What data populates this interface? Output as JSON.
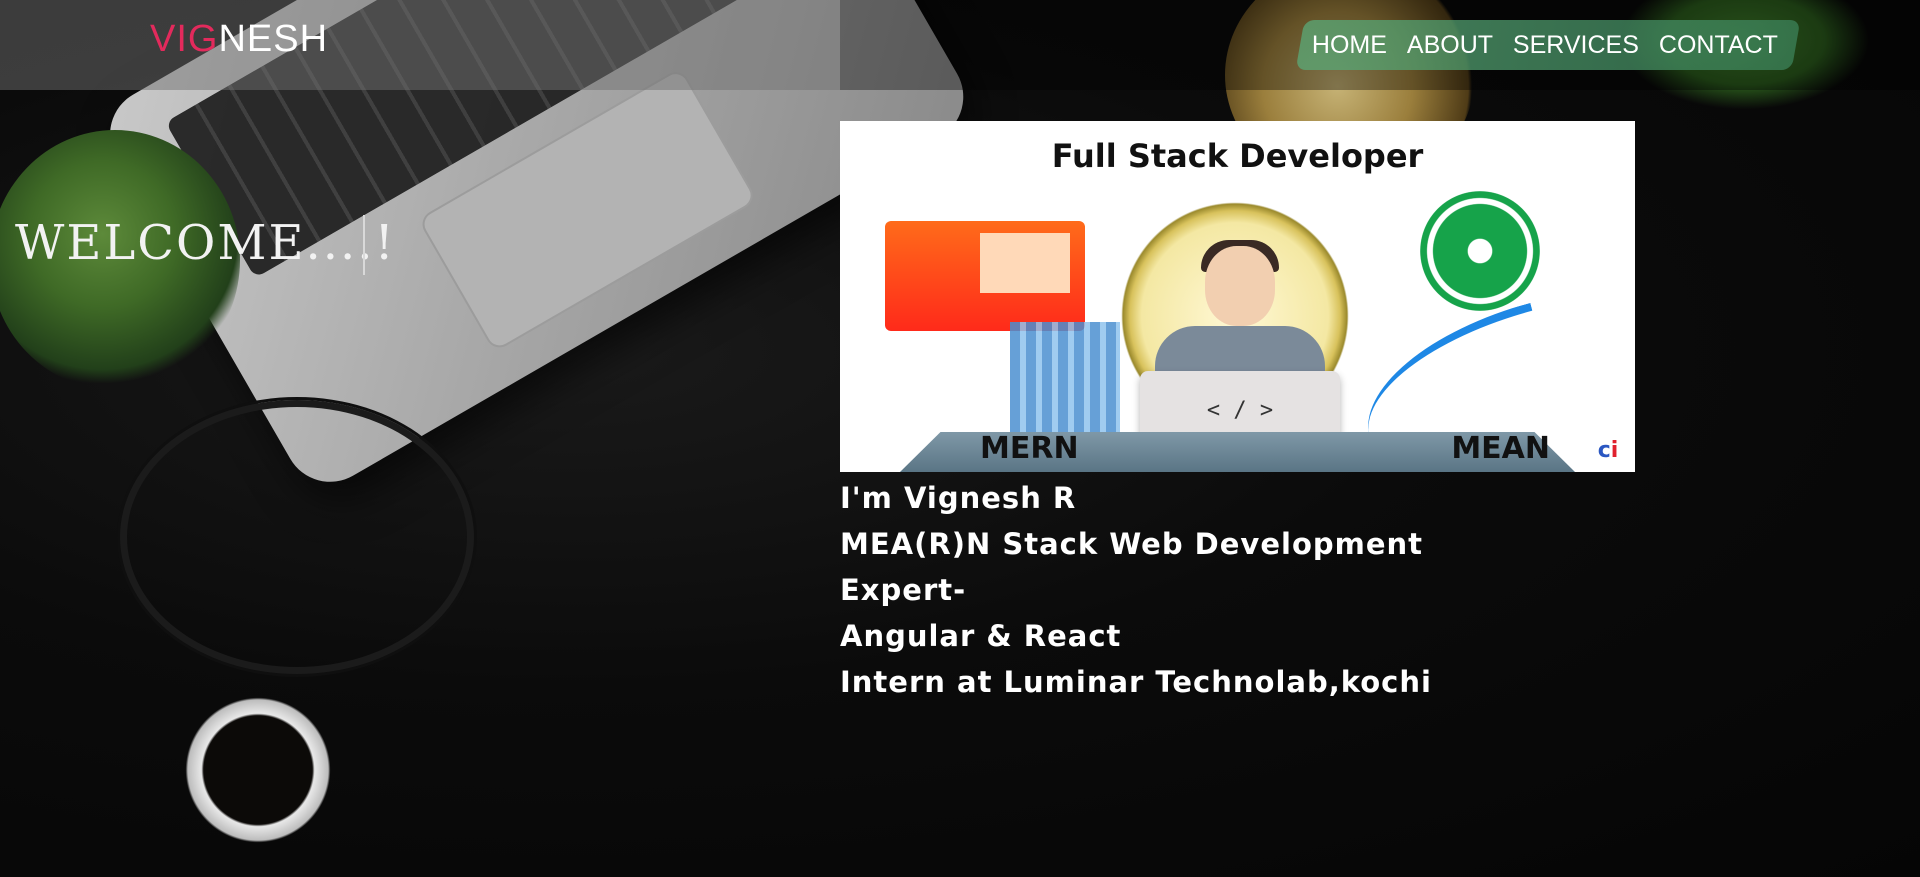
{
  "brand": {
    "part1": "VIG",
    "part2": "NESH",
    "accent_color": "#e32a5c"
  },
  "nav": {
    "items": [
      "HOME",
      "ABOUT",
      "SERVICES",
      "CONTACT"
    ]
  },
  "hero_section": {
    "welcome": "WELCOME....!"
  },
  "banner": {
    "title": "Full Stack Developer",
    "left_label": "MERN",
    "right_label": "MEAN",
    "code_symbol": "< / >",
    "logo_c": "c",
    "logo_i": "i"
  },
  "intro": {
    "line1": "I'm Vignesh R",
    "line2": "MEA(R)N Stack Web Development Expert-",
    "line3": "Angular & React",
    "line4": "Intern at Luminar Technolab,kochi"
  },
  "icons": [
    "laptop-photo",
    "plant-photo",
    "headphones-photo",
    "coffee-cup-photo",
    "globe-photo"
  ]
}
